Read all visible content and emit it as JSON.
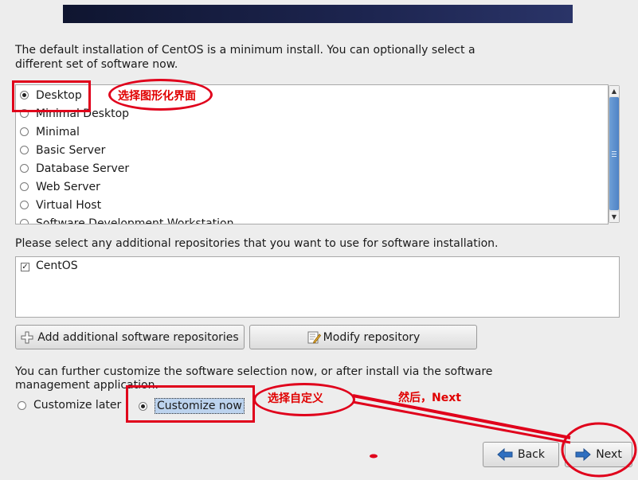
{
  "intro_text": "The default installation of CentOS is a minimum install. You can optionally select a different set of software now.",
  "software_options": [
    {
      "label": "Desktop",
      "selected": true
    },
    {
      "label": "Minimal Desktop",
      "selected": false
    },
    {
      "label": "Minimal",
      "selected": false
    },
    {
      "label": "Basic Server",
      "selected": false
    },
    {
      "label": "Database Server",
      "selected": false
    },
    {
      "label": "Web Server",
      "selected": false
    },
    {
      "label": "Virtual Host",
      "selected": false
    },
    {
      "label": "Software Development Workstation",
      "selected": false
    }
  ],
  "repositories": {
    "prompt": "Please select any additional repositories that you want to use for software installation.",
    "items": [
      {
        "label": "CentOS",
        "checked": true
      }
    ],
    "add_button": "Add additional software repositories",
    "modify_button": "Modify repository"
  },
  "customize": {
    "text": "You can further customize the software selection now, or after install via the software management application.",
    "later_label": "Customize later",
    "now_label": "Customize now",
    "selected": "now"
  },
  "nav": {
    "back_label": "Back",
    "next_label": "Next"
  },
  "annotations": {
    "desktop_note": "选择图形化界面",
    "customize_note": "选择自定义",
    "next_note": "然后，Next"
  },
  "colors": {
    "annotation_red": "#e0001b",
    "selection_blue": "#bcd3ee",
    "scroll_thumb": "#5a8fd0"
  }
}
